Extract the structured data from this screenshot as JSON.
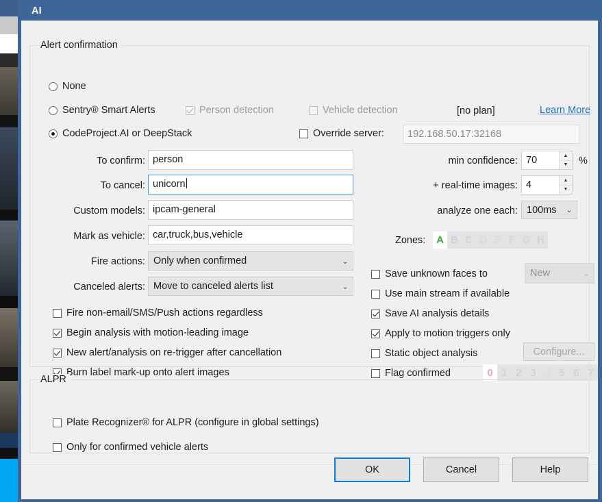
{
  "window": {
    "title": "AI"
  },
  "alert_group": {
    "title": "Alert confirmation",
    "radios": [
      {
        "label": "None",
        "checked": false
      },
      {
        "label": "Sentry® Smart Alerts",
        "checked": false
      },
      {
        "label": "CodeProject.AI or DeepStack",
        "checked": true
      }
    ],
    "person_detection": {
      "label": "Person detection",
      "checked": true,
      "enabled": false
    },
    "vehicle_detection": {
      "label": "Vehicle detection",
      "checked": false,
      "enabled": false
    },
    "plan_status": "[no plan]",
    "learn_more": "Learn More",
    "override_server": {
      "label": "Override server:",
      "checked": false
    },
    "server_address": "192.168.50.17:32168",
    "fields": [
      {
        "label": "To confirm:",
        "value": "person",
        "focused": false
      },
      {
        "label": "To cancel:",
        "value": "unicorn",
        "focused": true
      },
      {
        "label": "Custom models:",
        "value": "ipcam-general",
        "focused": false
      },
      {
        "label": "Mark as vehicle:",
        "value": "car,truck,bus,vehicle",
        "focused": false
      }
    ],
    "fire_actions": {
      "label": "Fire actions:",
      "value": "Only when confirmed"
    },
    "canceled_alerts": {
      "label": "Canceled alerts:",
      "value": "Move to canceled alerts list"
    },
    "min_confidence": {
      "label": "min confidence:",
      "value": "70",
      "unit": "%"
    },
    "realtime_images": {
      "label": "+ real-time images:",
      "value": "4"
    },
    "analyze_one_each": {
      "label": "analyze one each:",
      "value": "100ms"
    },
    "zones": {
      "label": "Zones:",
      "chips": [
        {
          "letter": "A",
          "color": "#3eae3e",
          "active": true
        },
        {
          "letter": "B",
          "color": "#b9c1dd",
          "active": false
        },
        {
          "letter": "C",
          "color": "#e4bcbc",
          "active": false
        },
        {
          "letter": "D",
          "color": "#e2d49e",
          "active": false
        },
        {
          "letter": "E",
          "color": "#d8d8d8",
          "active": false
        },
        {
          "letter": "F",
          "color": "#e0c7ad",
          "active": false
        },
        {
          "letter": "G",
          "color": "#bcd8d0",
          "active": false
        },
        {
          "letter": "H",
          "color": "#ddbedd",
          "active": false
        }
      ]
    },
    "left_checkboxes": [
      {
        "label": "Fire non-email/SMS/Push actions regardless",
        "checked": false
      },
      {
        "label": "Begin analysis with motion-leading image",
        "checked": true
      },
      {
        "label": "New alert/analysis on re-trigger after cancellation",
        "checked": true
      },
      {
        "label": "Burn label mark-up onto alert images",
        "checked": true
      }
    ],
    "right_checkboxes": [
      {
        "label": "Save unknown faces to",
        "checked": false
      },
      {
        "label": "Use main stream if available",
        "checked": false
      },
      {
        "label": "Save AI analysis details",
        "checked": true
      },
      {
        "label": "Apply to motion triggers only",
        "checked": true
      },
      {
        "label": "Static object analysis",
        "checked": false
      },
      {
        "label": "Flag confirmed",
        "checked": false
      }
    ],
    "faces_folder": {
      "value": "New",
      "enabled": false
    },
    "configure_button": {
      "label": "Configure...",
      "enabled": false
    },
    "flag_digits": [
      {
        "digit": "0",
        "color": "#e8a7a7",
        "active": true
      },
      {
        "digit": "1",
        "color": "#b7d9b0",
        "active": false
      },
      {
        "digit": "2",
        "color": "#aec4de",
        "active": false
      },
      {
        "digit": "3",
        "color": "#e3b6b6",
        "active": false
      },
      {
        "digit": "4",
        "color": "#e6dfa8",
        "active": false
      },
      {
        "digit": "5",
        "color": "#e7bfa4",
        "active": false
      },
      {
        "digit": "6",
        "color": "#cbbedd",
        "active": false
      },
      {
        "digit": "7",
        "color": "#a9d6c9",
        "active": false
      }
    ]
  },
  "alpr_group": {
    "title": "ALPR",
    "checkboxes": [
      {
        "label": "Plate Recognizer® for ALPR (configure in global settings)",
        "checked": false
      },
      {
        "label": "Only for confirmed vehicle alerts",
        "checked": false
      }
    ]
  },
  "buttons": {
    "ok": "OK",
    "cancel": "Cancel",
    "help": "Help"
  }
}
